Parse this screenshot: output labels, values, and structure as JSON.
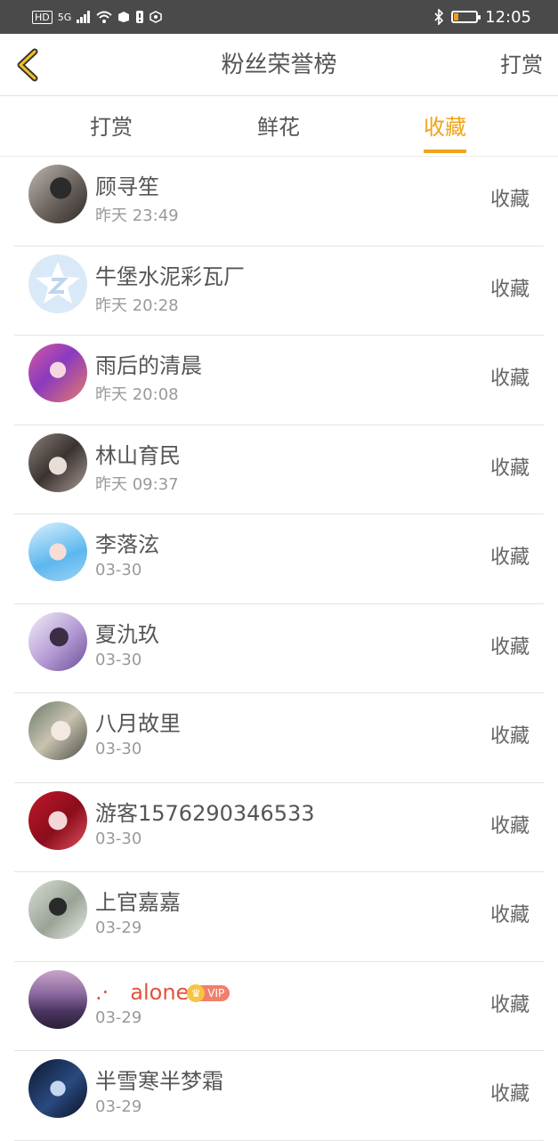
{
  "status_bar": {
    "time": "12:05",
    "hd_label": "HD",
    "net_label": "5G"
  },
  "nav": {
    "title": "粉丝荣誉榜",
    "right_label": "打赏"
  },
  "tabs": [
    {
      "label": "打赏",
      "active": false
    },
    {
      "label": "鲜花",
      "active": false
    },
    {
      "label": "收藏",
      "active": true
    }
  ],
  "colors": {
    "accent": "#f0a31b",
    "vip": "#f07f6d",
    "status_bar": "#4a4a4a"
  },
  "fans": [
    {
      "name": "顾寻笙",
      "time": "昨天 23:49",
      "action": "收藏"
    },
    {
      "name": "牛堡水泥彩瓦厂",
      "time": "昨天 20:28",
      "action": "收藏"
    },
    {
      "name": "雨后的清晨",
      "time": "昨天 20:08",
      "action": "收藏"
    },
    {
      "name": "林山育民",
      "time": "昨天 09:37",
      "action": "收藏"
    },
    {
      "name": "李落泫",
      "time": "03-30",
      "action": "收藏"
    },
    {
      "name": "夏氿玖",
      "time": "03-30",
      "action": "收藏"
    },
    {
      "name": "八月故里",
      "time": "03-30",
      "action": "收藏"
    },
    {
      "name": "游客1576290346533",
      "time": "03-30",
      "action": "收藏"
    },
    {
      "name": "上官嘉嘉",
      "time": "03-29",
      "action": "收藏"
    },
    {
      "name": ".·　alone",
      "time": "03-29",
      "action": "收藏",
      "vip": "VIP"
    },
    {
      "name": "半雪寒半梦霜",
      "time": "03-29",
      "action": "收藏"
    }
  ]
}
